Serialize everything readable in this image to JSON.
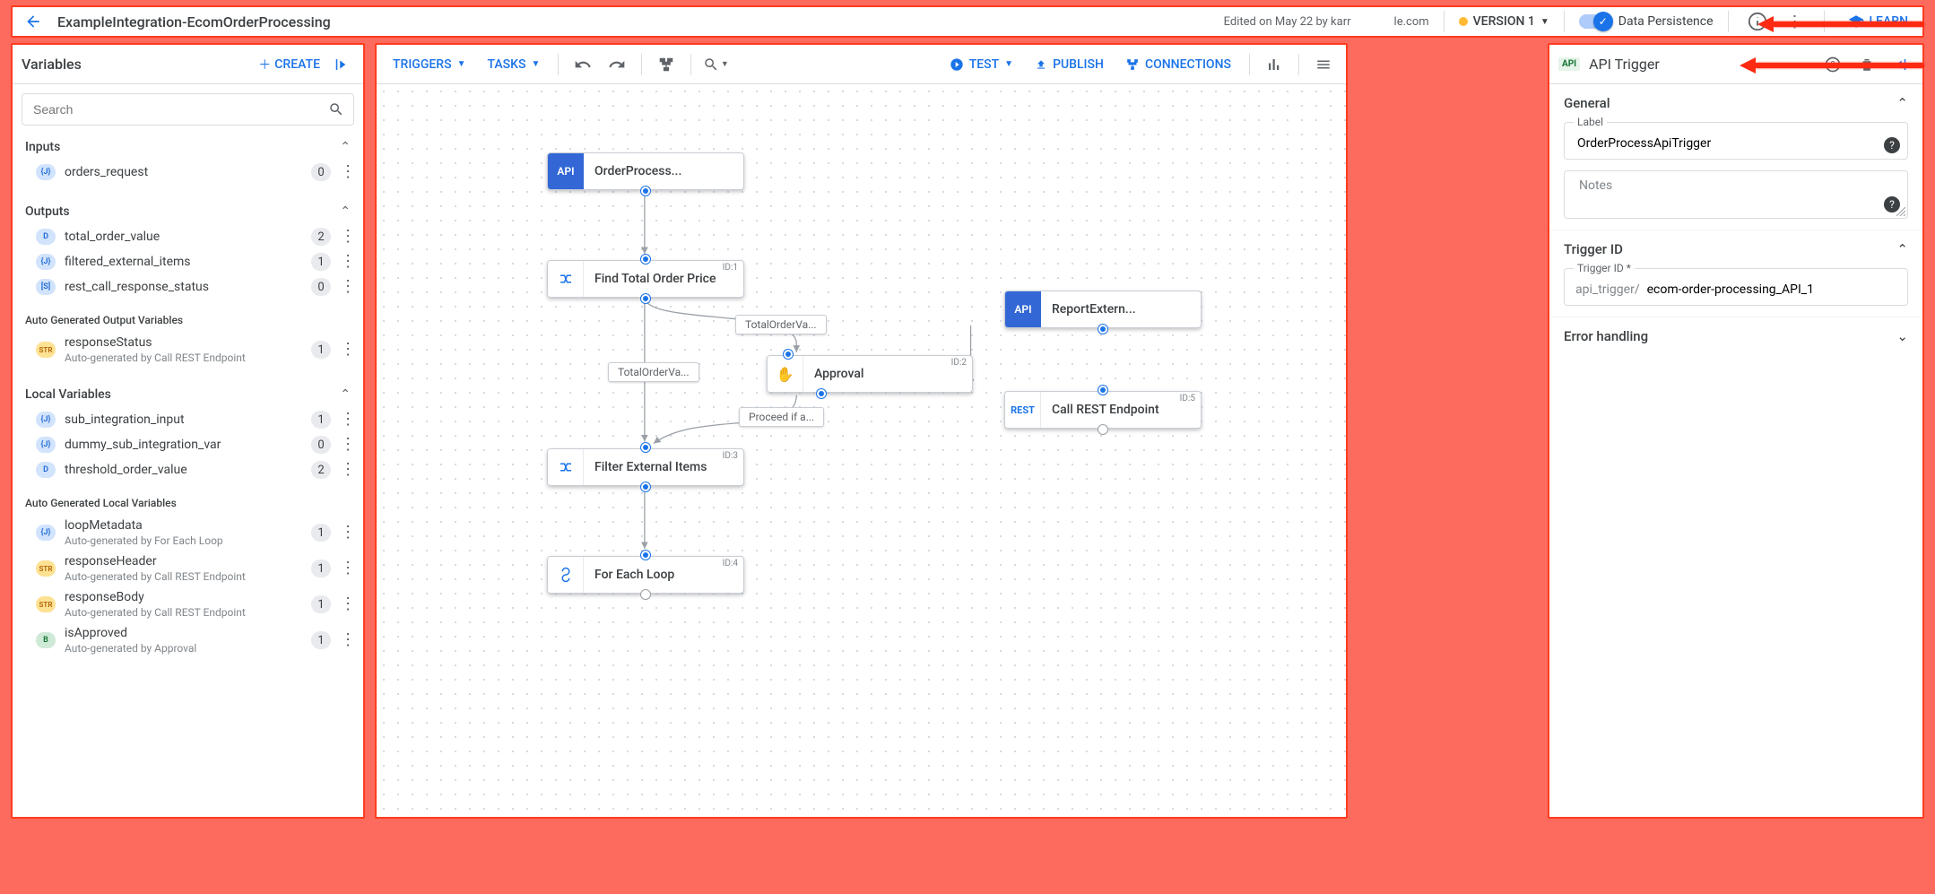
{
  "top": {
    "title": "ExampleIntegration-EcomOrderProcessing",
    "edited": "Edited on May 22 by karr",
    "domain": "le.com",
    "version": "VERSION 1",
    "data_persistence": "Data Persistence",
    "learn": "LEARN"
  },
  "left": {
    "title": "Variables",
    "create": "CREATE",
    "search_placeholder": "Search",
    "inputs_label": "Inputs",
    "outputs_label": "Outputs",
    "auto_out_label": "Auto Generated Output Variables",
    "locals_label": "Local Variables",
    "auto_local_label": "Auto Generated Local Variables",
    "auto_by_rest": "Auto-generated by Call REST Endpoint",
    "auto_by_loop": "Auto-generated by For Each Loop",
    "auto_by_approval": "Auto-generated by Approval",
    "inputs": [
      {
        "pill": "{J}",
        "name": "orders_request",
        "count": "0"
      }
    ],
    "outputs": [
      {
        "pill": "D",
        "name": "total_order_value",
        "count": "2"
      },
      {
        "pill": "{J}",
        "name": "filtered_external_items",
        "count": "1"
      },
      {
        "pill": "[S]",
        "name": "rest_call_response_status",
        "count": "0"
      }
    ],
    "auto_out": [
      {
        "pill": "STR",
        "name": "responseStatus",
        "sub": "auto_by_rest",
        "count": "1"
      }
    ],
    "locals": [
      {
        "pill": "{J}",
        "name": "sub_integration_input",
        "count": "1"
      },
      {
        "pill": "{J}",
        "name": "dummy_sub_integration_var",
        "count": "0"
      },
      {
        "pill": "D",
        "name": "threshold_order_value",
        "count": "2"
      }
    ],
    "auto_locals": [
      {
        "pill": "{J}",
        "name": "loopMetadata",
        "sub": "auto_by_loop",
        "count": "1"
      },
      {
        "pill": "STR",
        "name": "responseHeader",
        "sub": "auto_by_rest",
        "count": "1"
      },
      {
        "pill": "STR",
        "name": "responseBody",
        "sub": "auto_by_rest",
        "count": "1"
      },
      {
        "pill": "B",
        "name": "isApproved",
        "sub": "auto_by_approval",
        "count": "1"
      }
    ]
  },
  "mid": {
    "triggers": "TRIGGERS",
    "tasks": "TASKS",
    "test": "TEST",
    "publish": "PUBLISH",
    "connections": "CONNECTIONS",
    "nodes": {
      "n_api1": "OrderProcess...",
      "n_find": "Find Total Order Price",
      "n_approval": "Approval",
      "n_filter": "Filter External Items",
      "n_foreach": "For Each Loop",
      "n_api2": "ReportExtern...",
      "n_rest": "Call REST Endpoint"
    },
    "ids": {
      "id1": "ID:1",
      "id2": "ID:2",
      "id3": "ID:3",
      "id4": "ID:4",
      "id5": "ID:5"
    },
    "edges": {
      "e1": "TotalOrderVa...",
      "e2": "TotalOrderVa...",
      "e3": "Proceed if a..."
    }
  },
  "right": {
    "title": "API Trigger",
    "general": "General",
    "label_lbl": "Label",
    "label_val": "OrderProcessApiTrigger",
    "notes_lbl": "Notes",
    "trigger_id_section": "Trigger ID",
    "trigger_id_lbl": "Trigger ID *",
    "trigger_id_prefix": "api_trigger/",
    "trigger_id_val": "ecom-order-processing_API_1",
    "error_handling": "Error handling"
  }
}
